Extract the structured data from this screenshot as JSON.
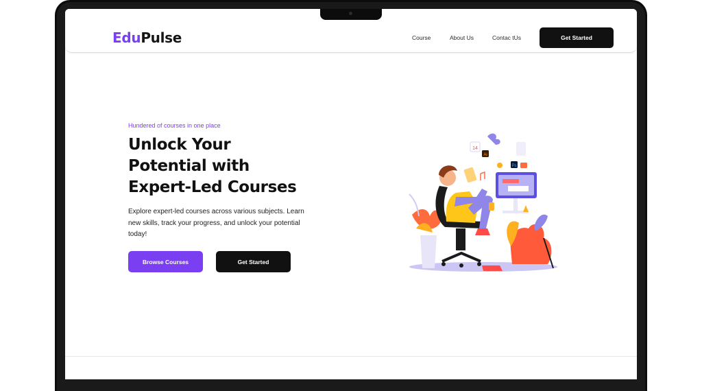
{
  "brand": {
    "logo_part1": "Edu",
    "logo_part2": "Pulse",
    "accent_color": "#7a3ff0",
    "dark_color": "#111111"
  },
  "nav": {
    "links": [
      "Course",
      "About Us",
      "Contac tUs"
    ],
    "cta_label": "Get Started"
  },
  "hero": {
    "eyebrow": "Hundered of courses in one place",
    "title": "Unlock Your Potential with Expert-Led Courses",
    "description": "Explore expert-led courses across various subjects. Learn new skills, track your progress, and unlock your potential today!",
    "primary_button": "Browse Courses",
    "secondary_button": "Get Started"
  },
  "illustration": {
    "icon": "student-studying-illustration",
    "calendar_day": "14",
    "app_badge_1": "Ai",
    "app_badge_2": "Ps"
  }
}
